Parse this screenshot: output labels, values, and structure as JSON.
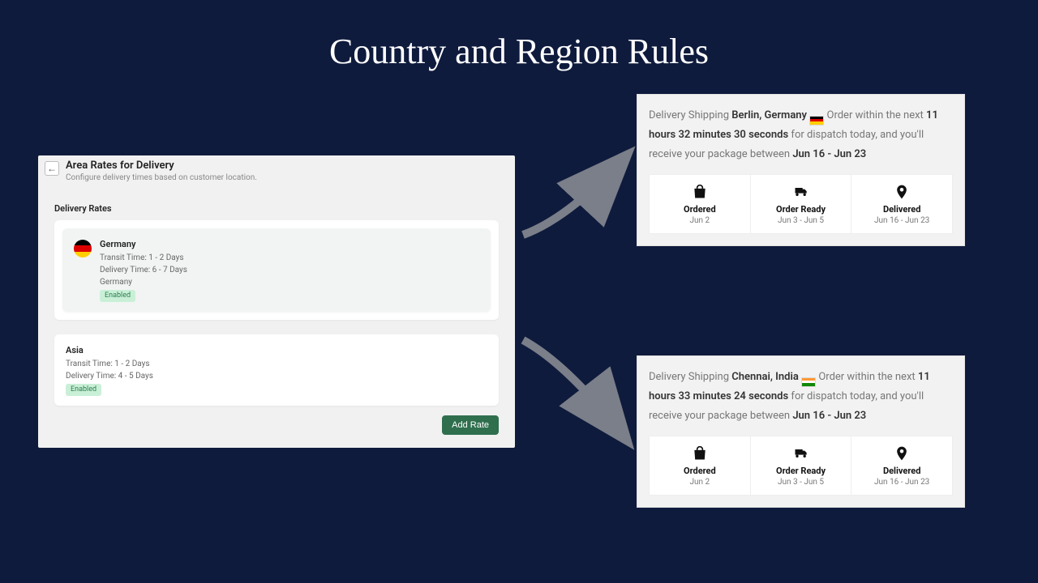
{
  "page": {
    "title": "Country and Region Rules"
  },
  "admin": {
    "header_title": "Area Rates for Delivery",
    "header_sub": "Configure delivery times based on customer location.",
    "section_label": "Delivery Rates",
    "add_rate_label": "Add Rate",
    "rates": [
      {
        "name": "Germany",
        "transit": "Transit Time: 1 - 2 Days",
        "delivery": "Delivery Time: 6 - 7 Days",
        "region": "Germany",
        "status": "Enabled"
      },
      {
        "name": "Asia",
        "transit": "Transit Time: 1 - 2 Days",
        "delivery": "Delivery Time: 4 - 5 Days",
        "status": "Enabled"
      }
    ]
  },
  "estimates": [
    {
      "prefix": "Delivery Shipping",
      "location": "Berlin, Germany",
      "flag": "de",
      "mid1": "Order within the next",
      "countdown": "11 hours 32 minutes 30 seconds",
      "mid2": "for dispatch today, and you'll receive your package between",
      "range": "Jun 16 - Jun 23",
      "steps": [
        {
          "label": "Ordered",
          "value": "Jun 2"
        },
        {
          "label": "Order Ready",
          "value": "Jun 3 - Jun 5"
        },
        {
          "label": "Delivered",
          "value": "Jun 16 - Jun 23"
        }
      ]
    },
    {
      "prefix": "Delivery Shipping",
      "location": "Chennai, India",
      "flag": "in",
      "mid1": "Order within the next",
      "countdown": "11 hours 33 minutes 24 seconds",
      "mid2": "for dispatch today, and you'll receive your package between",
      "range": "Jun 16 - Jun 23",
      "steps": [
        {
          "label": "Ordered",
          "value": "Jun 2"
        },
        {
          "label": "Order Ready",
          "value": "Jun 3 - Jun 5"
        },
        {
          "label": "Delivered",
          "value": "Jun 16 - Jun 23"
        }
      ]
    }
  ]
}
